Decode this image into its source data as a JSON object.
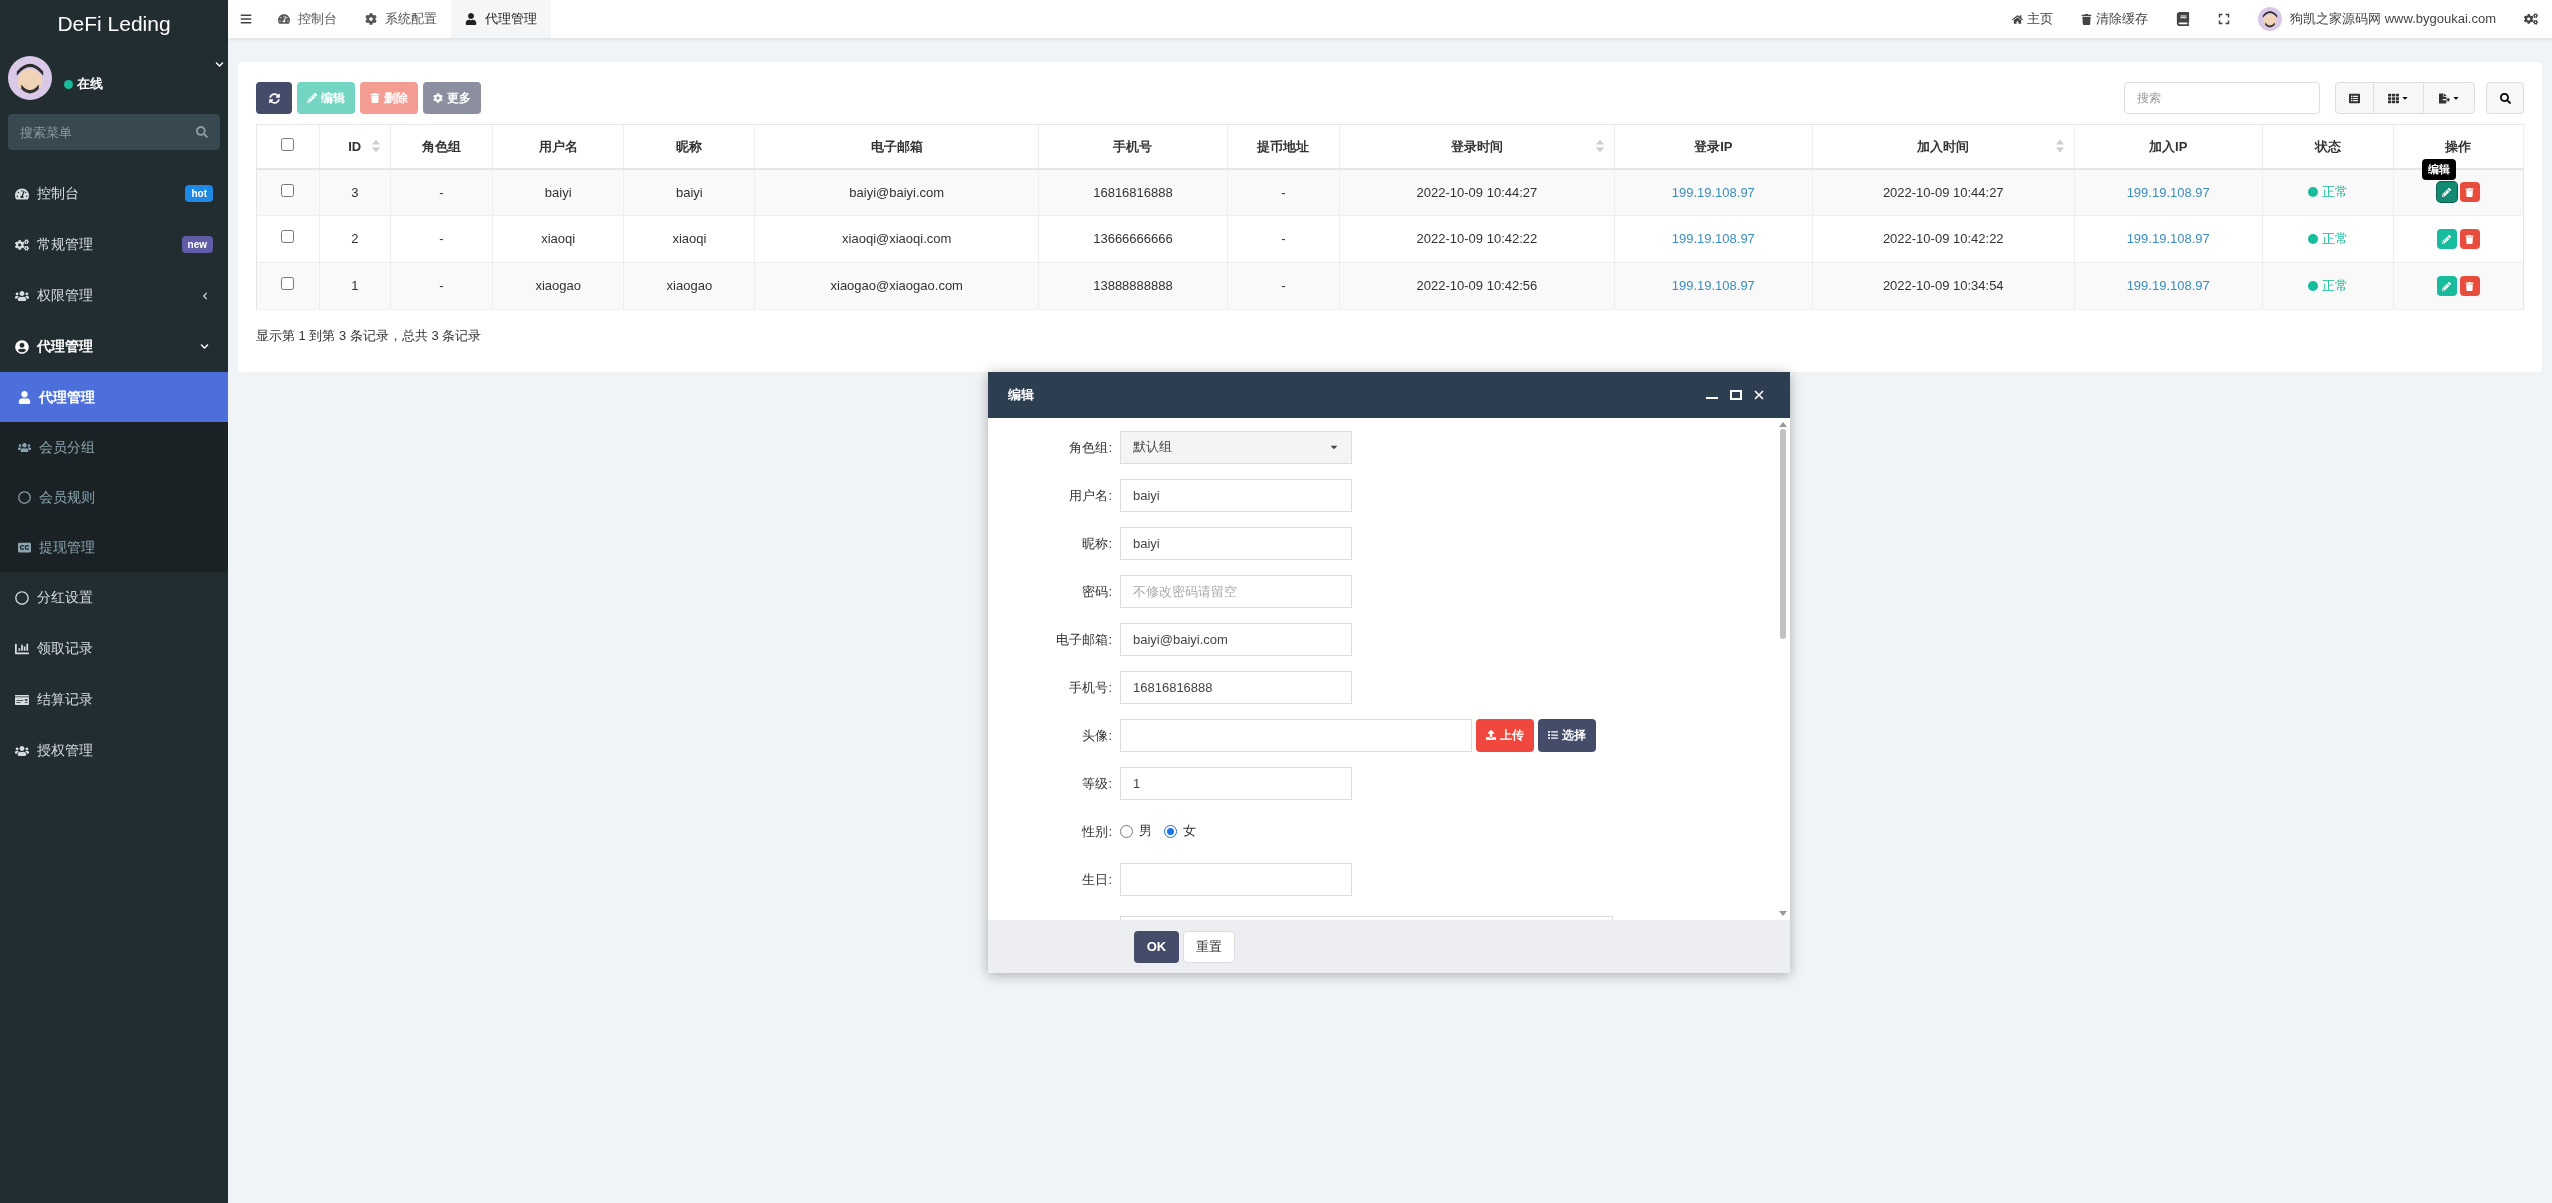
{
  "sidebar": {
    "logo": "DeFi Leding",
    "user": {
      "status": "在线"
    },
    "search": {
      "placeholder": "搜索菜单"
    },
    "items": [
      {
        "label": "控制台",
        "badge": {
          "text": "hot",
          "color": "#1e88e5"
        }
      },
      {
        "label": "常规管理",
        "badge": {
          "text": "new",
          "color": "#605ca8"
        }
      },
      {
        "label": "权限管理",
        "expanded": false
      },
      {
        "label": "代理管理",
        "expanded": true,
        "children": [
          {
            "label": "代理管理",
            "selected": true
          },
          {
            "label": "会员分组",
            "selected": false
          },
          {
            "label": "会员规则",
            "selected": false
          },
          {
            "label": "提现管理",
            "selected": false
          }
        ]
      },
      {
        "label": "分红设置"
      },
      {
        "label": "领取记录"
      },
      {
        "label": "结算记录"
      },
      {
        "label": "授权管理"
      }
    ]
  },
  "topbar": {
    "tabs": [
      {
        "label": "控制台",
        "selected": false
      },
      {
        "label": "系统配置",
        "selected": false
      },
      {
        "label": "代理管理",
        "selected": true
      }
    ],
    "links": [
      "主页",
      "清除缓存"
    ],
    "user": "狗凯之家源码网 www.bygoukai.com"
  },
  "toolbar": {
    "buttons": [
      {
        "label": "编辑",
        "kind": "edit"
      },
      {
        "label": "删除",
        "kind": "delete"
      },
      {
        "label": "更多",
        "kind": "more"
      }
    ],
    "search": {
      "placeholder": "搜索"
    }
  },
  "table": {
    "select_all_checked": false,
    "columns": [
      {
        "label": "ID",
        "sortable": true
      },
      {
        "label": "角色组",
        "sortable": false
      },
      {
        "label": "用户名",
        "sortable": false
      },
      {
        "label": "昵称",
        "sortable": false
      },
      {
        "label": "电子邮箱",
        "sortable": false
      },
      {
        "label": "手机号",
        "sortable": false
      },
      {
        "label": "提币地址",
        "sortable": false
      },
      {
        "label": "登录时间",
        "sortable": true
      },
      {
        "label": "登录IP",
        "sortable": false
      },
      {
        "label": "加入时间",
        "sortable": true
      },
      {
        "label": "加入IP",
        "sortable": false
      },
      {
        "label": "状态",
        "sortable": false
      },
      {
        "label": "操作",
        "sortable": false
      }
    ],
    "rows": [
      {
        "checked": false,
        "cells": [
          "3",
          "-",
          "baiyi",
          "baiyi",
          "baiyi@baiyi.com",
          "16816816888",
          "-",
          "2022-10-09 10:44:27",
          "199.19.108.97",
          "2022-10-09 10:44:27",
          "199.19.108.97"
        ],
        "status": {
          "text": "正常",
          "color": "#18bc9c"
        },
        "hovered": true
      },
      {
        "checked": false,
        "cells": [
          "2",
          "-",
          "xiaoqi",
          "xiaoqi",
          "xiaoqi@xiaoqi.com",
          "13666666666",
          "-",
          "2022-10-09 10:42:22",
          "199.19.108.97",
          "2022-10-09 10:42:22",
          "199.19.108.97"
        ],
        "status": {
          "text": "正常",
          "color": "#18bc9c"
        },
        "hovered": false
      },
      {
        "checked": false,
        "cells": [
          "1",
          "-",
          "xiaogao",
          "xiaogao",
          "xiaogao@xiaogao.com",
          "13888888888",
          "-",
          "2022-10-09 10:42:56",
          "199.19.108.97",
          "2022-10-09 10:34:54",
          "199.19.108.97"
        ],
        "status": {
          "text": "正常",
          "color": "#18bc9c"
        },
        "hovered": false
      }
    ],
    "tooltip": "编辑",
    "summary": "显示第 1 到第 3 条记录，总共 3 条记录"
  },
  "dialog": {
    "title": "编辑",
    "fields": [
      {
        "kind": "select",
        "label": "角色组:",
        "value": "默认组"
      },
      {
        "kind": "text",
        "label": "用户名:",
        "value": "baiyi"
      },
      {
        "kind": "text",
        "label": "昵称:",
        "value": "baiyi"
      },
      {
        "kind": "text",
        "label": "密码:",
        "placeholder": "不修改密码请留空"
      },
      {
        "kind": "text",
        "label": "电子邮箱:",
        "value": "baiyi@baiyi.com"
      },
      {
        "kind": "text",
        "label": "手机号:",
        "value": "16816816888"
      },
      {
        "kind": "upload",
        "label": "头像:",
        "buttons": [
          "上传",
          "选择"
        ]
      },
      {
        "kind": "text",
        "label": "等级:",
        "value": "1"
      },
      {
        "kind": "radio",
        "label": "性别:",
        "options": [
          {
            "label": "男",
            "selected": false
          },
          {
            "label": "女",
            "selected": true
          }
        ]
      },
      {
        "kind": "text",
        "label": "生日:"
      },
      {
        "kind": "textarea"
      }
    ],
    "buttons": [
      "OK",
      "重置"
    ]
  }
}
